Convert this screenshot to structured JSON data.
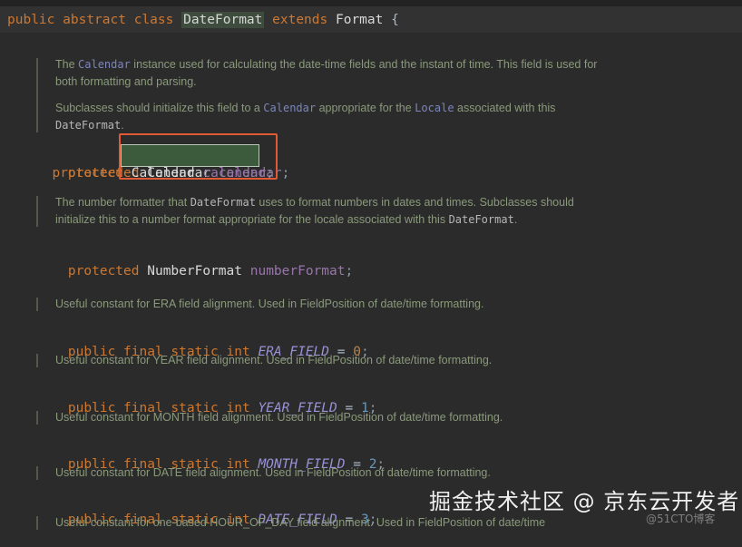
{
  "editor": {
    "theme": {
      "background": "#2b2b2b",
      "class_band_background": "#323232",
      "top_strip_background": "#232323",
      "keyword_color": "#cc7832",
      "field_color": "#9876aa",
      "constant_color": "#9a92d6",
      "doc_text_color": "#8a9a7b",
      "doc_code_color": "#7b85bf",
      "number_color": "#6897bb",
      "selection_background": "#3c5a3c",
      "annotation_border_color": "#e05a36",
      "class_highlight_background": "#3d4c3d"
    },
    "class_declaration": {
      "keyword_public": "public",
      "keyword_abstract": "abstract",
      "keyword_class": "class",
      "class_name": "DateFormat",
      "keyword_extends": "extends",
      "super_class": "Format",
      "brace": "{"
    },
    "blocks": [
      {
        "id": "calendar-field",
        "doc_paragraphs": [
          [
            {
              "t": "The ",
              "k": "text"
            },
            {
              "t": "Calendar",
              "k": "code"
            },
            {
              "t": " instance used for calculating the date-time fields and the instant of time. This field is used for both formatting and parsing.",
              "k": "text"
            }
          ],
          [
            {
              "t": "Subclasses should initialize this field to a ",
              "k": "text"
            },
            {
              "t": "Calendar",
              "k": "code"
            },
            {
              "t": " appropriate for the ",
              "k": "text"
            },
            {
              "t": "Locale",
              "k": "code"
            },
            {
              "t": " associated with this ",
              "k": "text"
            },
            {
              "t": "DateFormat",
              "k": "code-gray"
            },
            {
              "t": ".",
              "k": "text"
            }
          ]
        ],
        "code": {
          "modifier": "protected",
          "type": "Calendar",
          "name": "calendar",
          "terminator": ";"
        },
        "annotated": true,
        "selected": true
      },
      {
        "id": "numberformat-field",
        "doc_paragraphs": [
          [
            {
              "t": "The number formatter that ",
              "k": "text"
            },
            {
              "t": "DateFormat",
              "k": "code-gray"
            },
            {
              "t": " uses to format numbers in dates and times. Subclasses should initialize this to a number format appropriate for the locale associated with this ",
              "k": "text"
            },
            {
              "t": "DateFormat",
              "k": "code-gray"
            },
            {
              "t": ".",
              "k": "text"
            }
          ]
        ],
        "code": {
          "modifier": "protected",
          "type": "NumberFormat",
          "name": "numberFormat",
          "terminator": ";"
        },
        "annotated": false,
        "selected": false
      }
    ],
    "constants": [
      {
        "doc": "Useful constant for ERA field alignment. Used in FieldPosition of date/time formatting.",
        "modifiers": "public final static int",
        "name": "ERA_FIELD",
        "assign": "=",
        "value": "0",
        "terminator": ";"
      },
      {
        "doc": "Useful constant for YEAR field alignment. Used in FieldPosition of date/time formatting.",
        "modifiers": "public final static int",
        "name": "YEAR_FIELD",
        "assign": "=",
        "value": "1",
        "terminator": ";"
      },
      {
        "doc": "Useful constant for MONTH field alignment. Used in FieldPosition of date/time formatting.",
        "modifiers": "public final static int",
        "name": "MONTH_FIELD",
        "assign": "=",
        "value": "2",
        "terminator": ";"
      },
      {
        "doc": "Useful constant for DATE field alignment. Used in FieldPosition of date/time formatting.",
        "modifiers": "public final static int",
        "name": "DATE_FIELD",
        "assign": "=",
        "value": "3",
        "terminator": ";"
      }
    ],
    "truncated_doc_line": "Useful constant for one-based HOUR_OF_DAY field alignment. Used in FieldPosition of date/time"
  },
  "watermarks": {
    "primary": "掘金技术社区 @ 京东云开发者",
    "secondary": "@51CTO博客"
  }
}
